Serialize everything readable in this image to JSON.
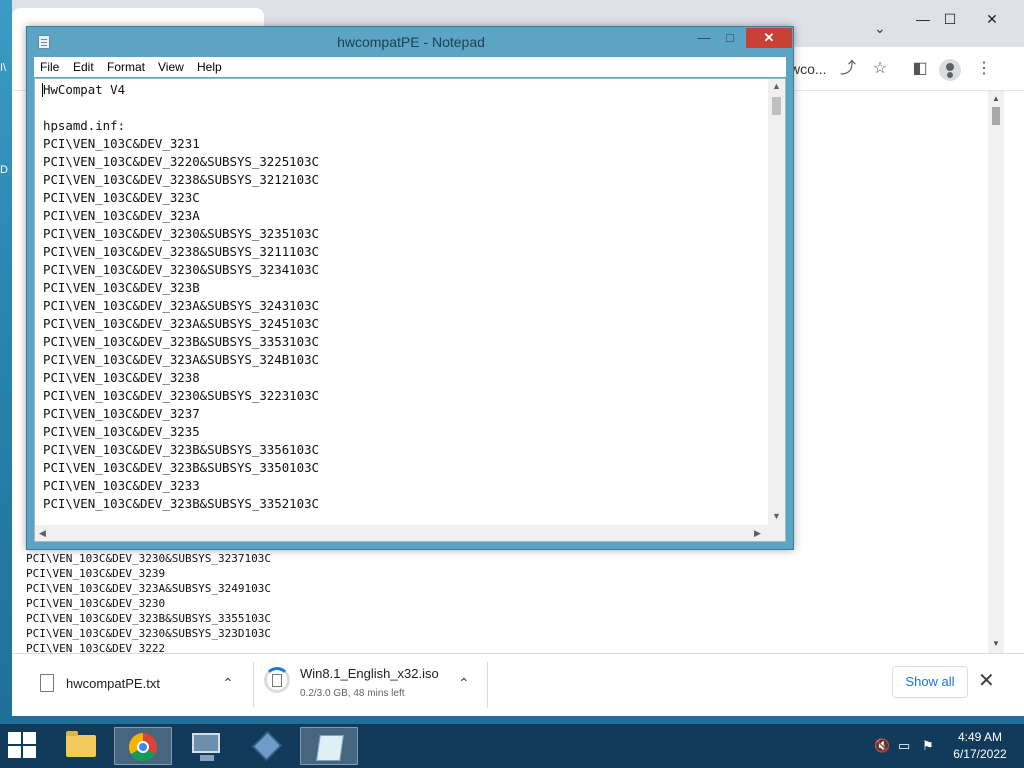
{
  "desktop": {
    "left_edge_chars": [
      "I\\",
      "D"
    ]
  },
  "chrome": {
    "tab_search_label": "⌄",
    "minimize": "—",
    "maximize": "☐",
    "close": "✕",
    "omnibox_text": "wco...",
    "page_lines": [
      "PCI\\VEN_103C&DEV_3230&SUBSYS_3237103C",
      "PCI\\VEN_103C&DEV_3239",
      "PCI\\VEN_103C&DEV_323A&SUBSYS_3249103C",
      "PCI\\VEN_103C&DEV_3230",
      "PCI\\VEN_103C&DEV_323B&SUBSYS_3355103C",
      "PCI\\VEN_103C&DEV_3230&SUBSYS_323D103C",
      "PCI\\VEN_103C&DEV_3222"
    ]
  },
  "downloads": {
    "items": [
      {
        "name": "hwcompatPE.txt",
        "status": ""
      },
      {
        "name": "Win8.1_English_x32.iso",
        "status": "0.2/3.0 GB, 48 mins left",
        "progress": 0.067
      }
    ],
    "show_all_label": "Show all",
    "close_label": "✕"
  },
  "notepad": {
    "title": "hwcompatPE - Notepad",
    "minimize": "—",
    "maximize": "□",
    "close": "✕",
    "menu": [
      "File",
      "Edit",
      "Format",
      "View",
      "Help"
    ],
    "lines": [
      "HwCompat V4",
      "",
      "hpsamd.inf:",
      "PCI\\VEN_103C&DEV_3231",
      "PCI\\VEN_103C&DEV_3220&SUBSYS_3225103C",
      "PCI\\VEN_103C&DEV_3238&SUBSYS_3212103C",
      "PCI\\VEN_103C&DEV_323C",
      "PCI\\VEN_103C&DEV_323A",
      "PCI\\VEN_103C&DEV_3230&SUBSYS_3235103C",
      "PCI\\VEN_103C&DEV_3238&SUBSYS_3211103C",
      "PCI\\VEN_103C&DEV_3230&SUBSYS_3234103C",
      "PCI\\VEN_103C&DEV_323B",
      "PCI\\VEN_103C&DEV_323A&SUBSYS_3243103C",
      "PCI\\VEN_103C&DEV_323A&SUBSYS_3245103C",
      "PCI\\VEN_103C&DEV_323B&SUBSYS_3353103C",
      "PCI\\VEN_103C&DEV_323A&SUBSYS_324B103C",
      "PCI\\VEN_103C&DEV_3238",
      "PCI\\VEN_103C&DEV_3230&SUBSYS_3223103C",
      "PCI\\VEN_103C&DEV_3237",
      "PCI\\VEN_103C&DEV_3235",
      "PCI\\VEN_103C&DEV_323B&SUBSYS_3356103C",
      "PCI\\VEN_103C&DEV_323B&SUBSYS_3350103C",
      "PCI\\VEN_103C&DEV_3233",
      "PCI\\VEN_103C&DEV_323B&SUBSYS_3352103C"
    ]
  },
  "taskbar": {
    "apps": [
      {
        "name": "file-explorer",
        "active": false
      },
      {
        "name": "chrome",
        "active": true
      },
      {
        "name": "computer",
        "active": false
      },
      {
        "name": "virtualbox",
        "active": false
      },
      {
        "name": "notepad",
        "active": true
      }
    ],
    "time": "4:49 AM",
    "date": "6/17/2022"
  },
  "colors": {
    "notepad_frame": "#5ba4c4",
    "notepad_close": "#c94134",
    "taskbar": "#123a5a",
    "link_blue": "#1a73e8"
  }
}
